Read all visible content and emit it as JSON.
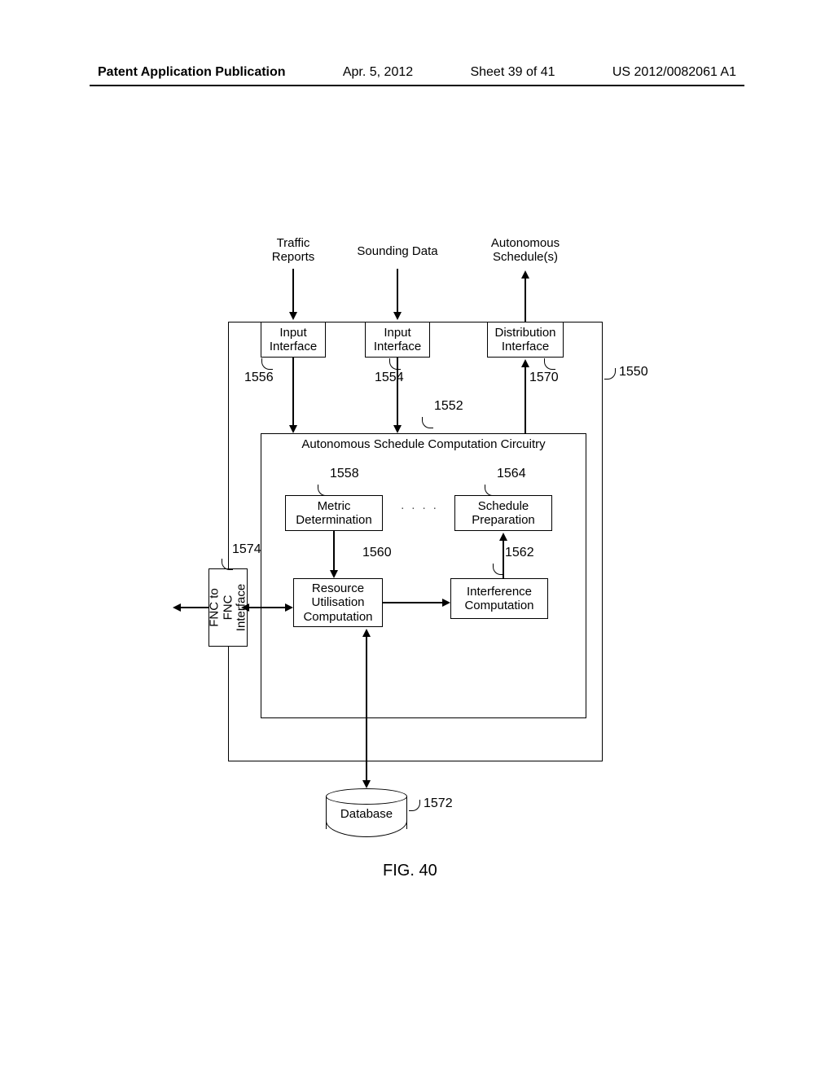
{
  "header": {
    "left": "Patent Application Publication",
    "date": "Apr. 5, 2012",
    "sheet": "Sheet 39 of 41",
    "pubno": "US 2012/0082061 A1"
  },
  "inputs": {
    "traffic": "Traffic\nReports",
    "sounding": "Sounding Data",
    "autonomous": "Autonomous\nSchedule(s)"
  },
  "boxes": {
    "input_if_1": "Input\nInterface",
    "input_if_2": "Input\nInterface",
    "dist_if": "Distribution\nInterface",
    "asc": "Autonomous Schedule Computation Circuitry",
    "metric": "Metric\nDetermination",
    "sched": "Schedule\nPreparation",
    "res": "Resource\nUtilisation\nComputation",
    "interf": "Interference\nComputation",
    "fnc": "FNC to FNC\nInterface",
    "db": "Database"
  },
  "refs": {
    "r1550": "1550",
    "r1552": "1552",
    "r1554": "1554",
    "r1556": "1556",
    "r1558": "1558",
    "r1560": "1560",
    "r1562": "1562",
    "r1564": "1564",
    "r1570": "1570",
    "r1572": "1572",
    "r1574": "1574"
  },
  "figure": "FIG. 40"
}
